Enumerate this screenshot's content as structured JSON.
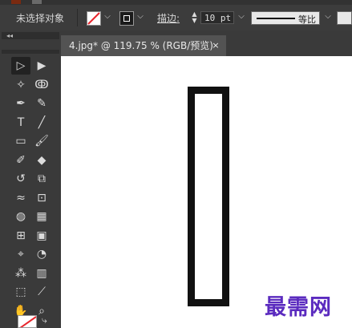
{
  "control_bar": {
    "selection_status": "未选择对象",
    "stroke_label": "描边",
    "stroke_colon": ":",
    "stroke_weight": "10 pt",
    "profile_label": "等比"
  },
  "document_tab": {
    "title": "4.jpg* @ 119.75 % (RGB/预览)",
    "close_glyph": "×"
  },
  "tools_panel": {
    "collapse_glyph": "◂◂",
    "tools": [
      "selection-tool",
      "direct-selection-tool",
      "magic-wand-tool",
      "lasso-tool",
      "pen-tool",
      "curvature-tool",
      "type-tool",
      "line-segment-tool",
      "rectangle-tool",
      "paintbrush-tool",
      "shaper-tool",
      "eraser-tool",
      "rotate-tool",
      "scale-tool",
      "warp-tool",
      "free-transform-tool",
      "shape-builder-tool",
      "perspective-grid-tool",
      "mesh-tool",
      "gradient-tool",
      "eyedropper-tool",
      "blend-tool",
      "symbol-sprayer-tool",
      "column-graph-tool",
      "artboard-tool",
      "slice-tool",
      "hand-tool",
      "zoom-tool"
    ]
  },
  "canvas": {
    "watermark": "最需网"
  },
  "colors": {
    "accent_red": "#e8262d",
    "watermark_purple": "#5b2bbf",
    "shape_stroke": "#111111"
  }
}
